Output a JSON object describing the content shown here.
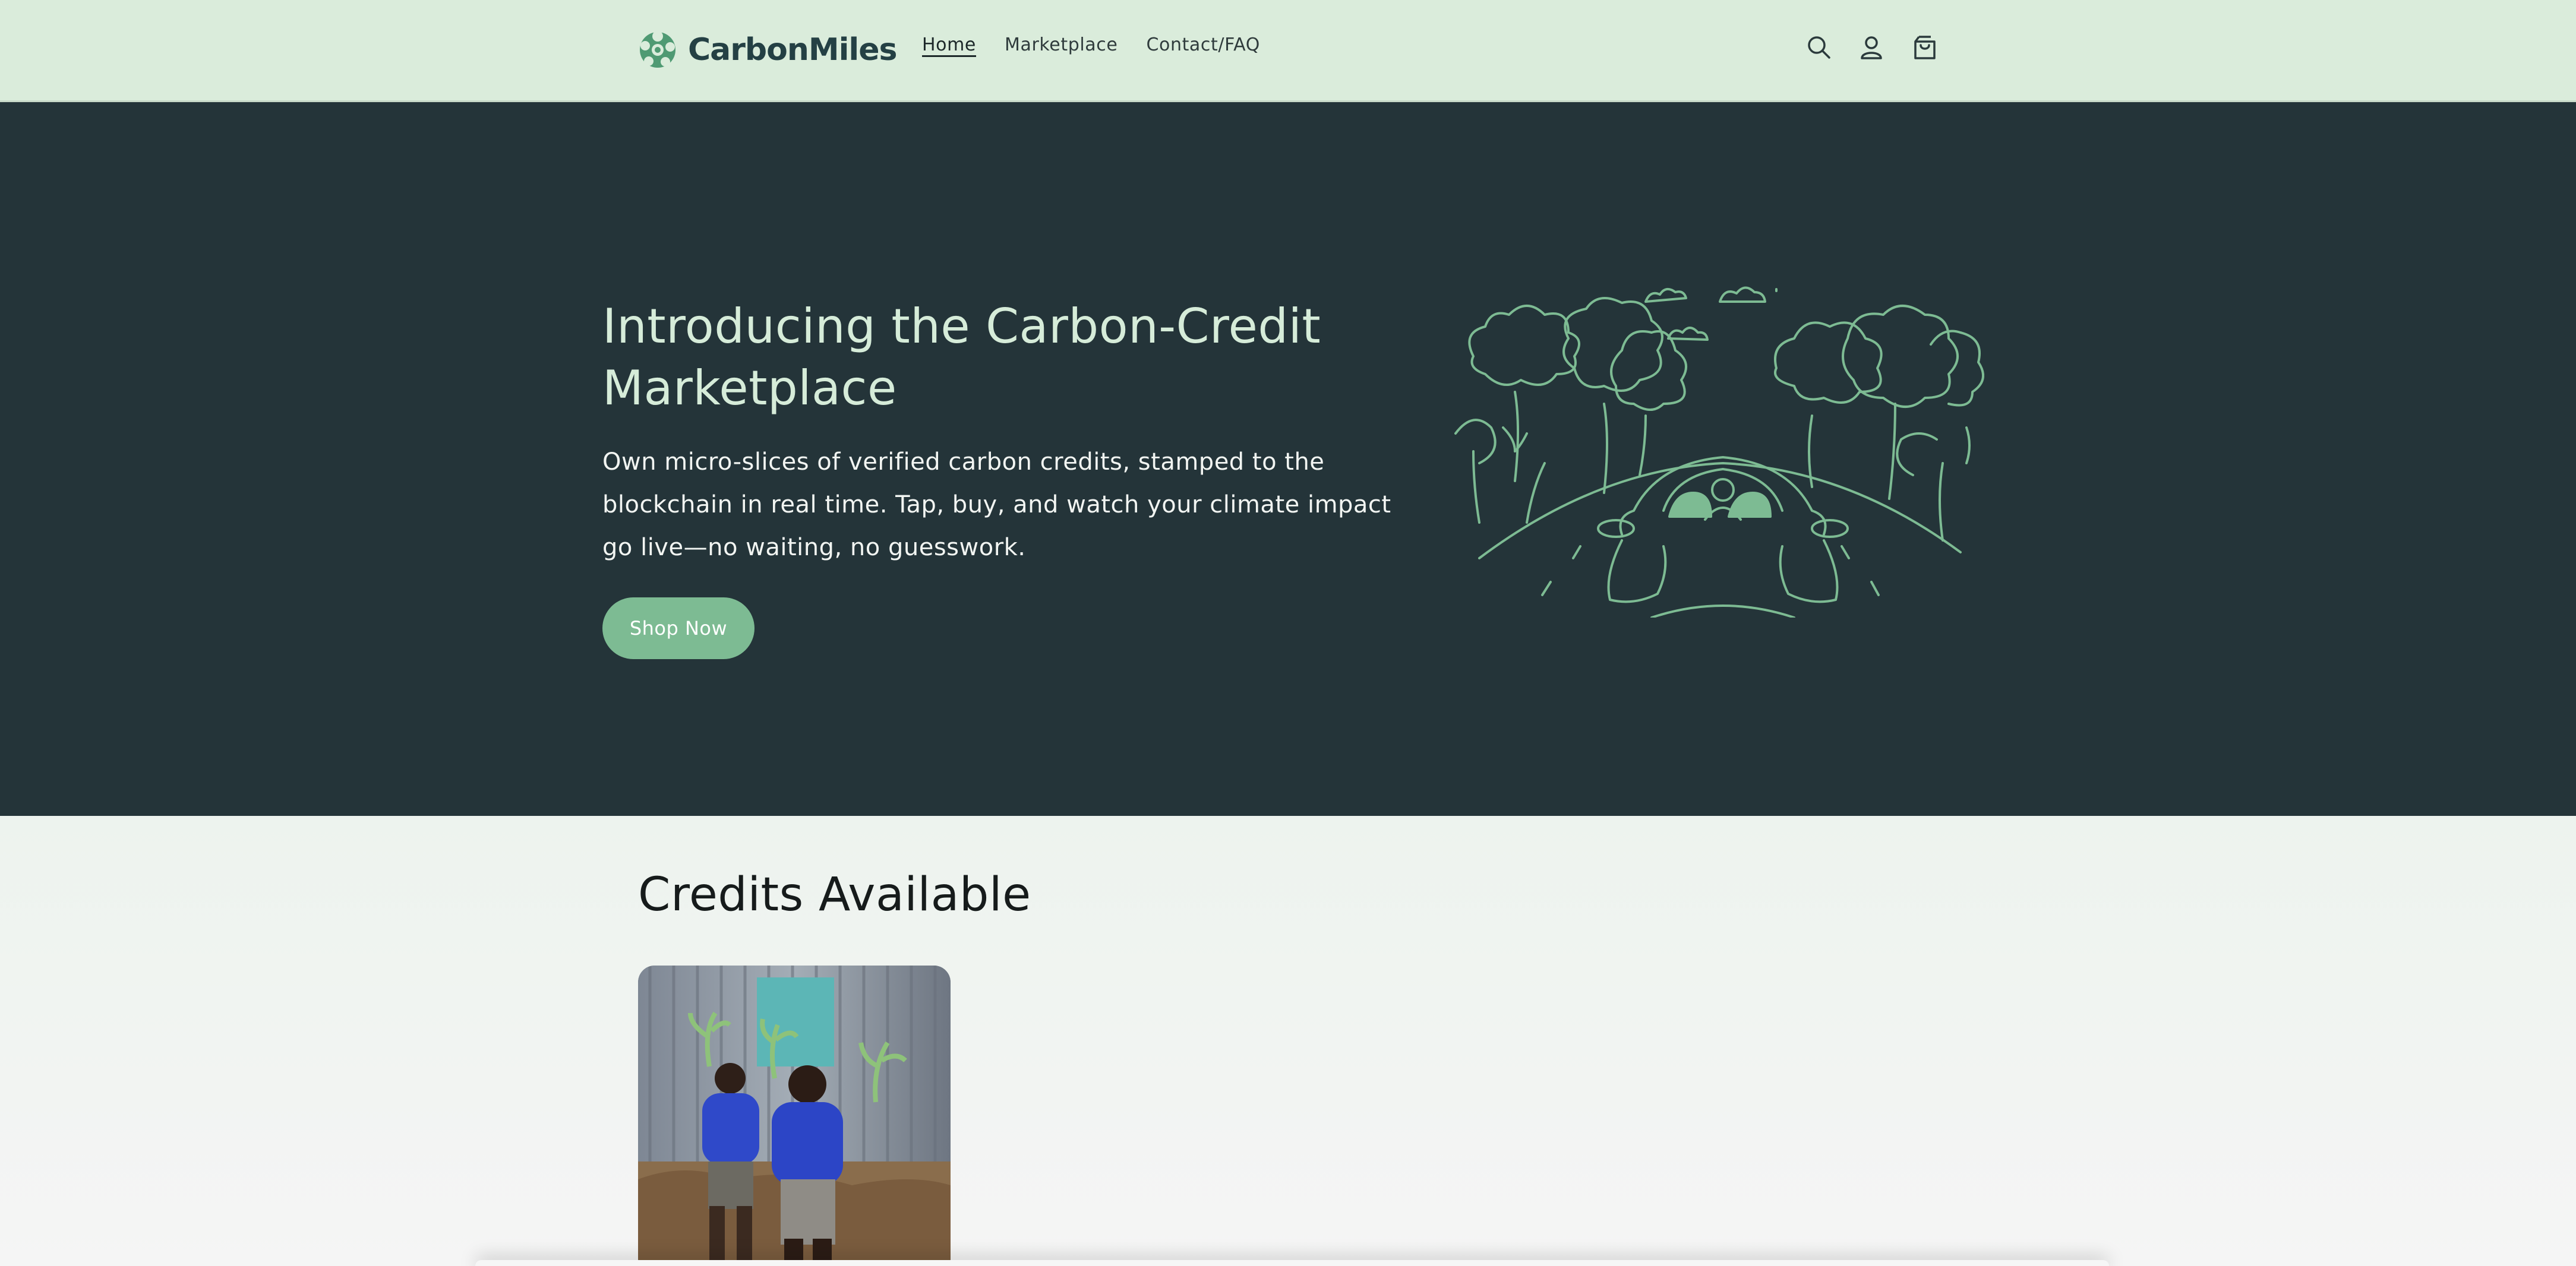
{
  "brand": {
    "name": "CarbonMiles"
  },
  "nav": {
    "items": [
      {
        "label": "Home",
        "active": true
      },
      {
        "label": "Marketplace",
        "active": false
      },
      {
        "label": "Contact/FAQ",
        "active": false
      }
    ]
  },
  "header_icons": [
    "search-icon",
    "account-icon",
    "cart-icon"
  ],
  "hero": {
    "title": "Introducing the Carbon-Credit Marketplace",
    "subtitle": "Own micro-slices of verified carbon credits, stamped to the blockchain in real time. Tap, buy, and watch your climate impact go live—no waiting, no guesswork.",
    "cta_label": "Shop Now"
  },
  "credits": {
    "title": "Credits Available"
  },
  "colors": {
    "header_bg": "#daecdb",
    "hero_bg": "#243439",
    "accent": "#7dbb93",
    "brand_text": "#244044"
  }
}
